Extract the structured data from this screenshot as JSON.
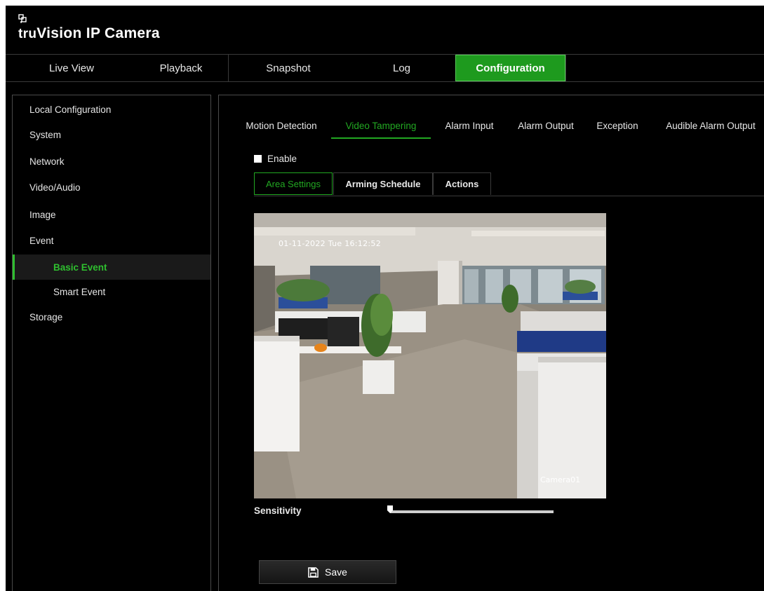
{
  "app": {
    "brand_small": "tru",
    "brand_main": "Vision",
    "brand_suffix": " IP Camera",
    "logo_icon": "network-grid-icon"
  },
  "topnav": {
    "tabs": [
      {
        "label": "Live View",
        "active": false
      },
      {
        "label": "Playback",
        "active": false
      },
      {
        "label": "Snapshot",
        "active": false
      },
      {
        "label": "Log",
        "active": false
      },
      {
        "label": "Configuration",
        "active": true
      }
    ]
  },
  "sidebar": {
    "items": [
      {
        "label": "Local Configuration",
        "level": 1
      },
      {
        "label": "System",
        "level": 1
      },
      {
        "label": "Network",
        "level": 1
      },
      {
        "label": "Video/Audio",
        "level": 1
      },
      {
        "label": "Image",
        "level": 1
      },
      {
        "label": "Event",
        "level": 1
      },
      {
        "label": "Basic Event",
        "level": 2,
        "active": true
      },
      {
        "label": "Smart Event",
        "level": 2
      },
      {
        "label": "Storage",
        "level": 1
      }
    ]
  },
  "event_tabs": [
    {
      "label": "Motion Detection"
    },
    {
      "label": "Video Tampering",
      "active": true
    },
    {
      "label": "Alarm Input"
    },
    {
      "label": "Alarm Output"
    },
    {
      "label": "Exception"
    },
    {
      "label": "Audible Alarm Output"
    }
  ],
  "enable": {
    "label": "Enable",
    "checked": false
  },
  "inner_tabs": [
    {
      "label": "Area Settings",
      "active": true
    },
    {
      "label": "Arming Schedule"
    },
    {
      "label": "Actions"
    }
  ],
  "video": {
    "osd_time": "01-11-2022 Tue 16:12:52",
    "osd_camera": "Camera01"
  },
  "sensitivity": {
    "label": "Sensitivity",
    "value_percent": 0
  },
  "save": {
    "label": "Save",
    "icon": "floppy-disk-icon"
  },
  "colors": {
    "accent": "#1e9a1e",
    "active_text": "#2fbf2f",
    "background": "#000000"
  }
}
